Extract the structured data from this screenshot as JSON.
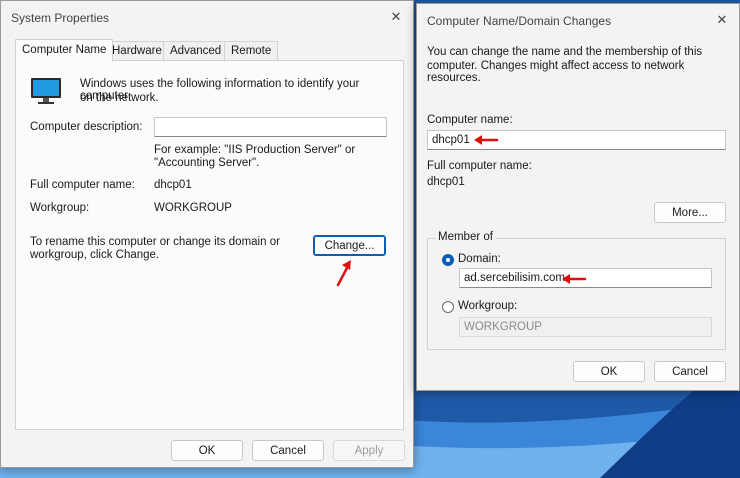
{
  "system_properties": {
    "title": "System Properties",
    "tabs": [
      {
        "label": "Computer Name",
        "active": true
      },
      {
        "label": "Hardware",
        "active": false
      },
      {
        "label": "Advanced",
        "active": false
      },
      {
        "label": "Remote",
        "active": false
      }
    ],
    "intro_line1": "Windows uses the following information to identify your computer",
    "intro_line2": "on the network.",
    "description_label": "Computer description:",
    "description_value": "",
    "example_line1": "For example: \"IIS Production Server\" or",
    "example_line2": "\"Accounting Server\".",
    "full_name_label": "Full computer name:",
    "full_name_value": "dhcp01",
    "workgroup_label": "Workgroup:",
    "workgroup_value": "WORKGROUP",
    "rename_line1": "To rename this computer or change its domain or",
    "rename_line2": "workgroup, click Change.",
    "change_button": "Change...",
    "ok_button": "OK",
    "cancel_button": "Cancel",
    "apply_button": "Apply"
  },
  "domain_changes": {
    "title": "Computer Name/Domain Changes",
    "intro_line1": "You can change the name and the membership of this",
    "intro_line2": "computer. Changes might affect access to network resources.",
    "computer_name_label": "Computer name:",
    "computer_name_value": "dhcp01",
    "full_name_label": "Full computer name:",
    "full_name_value": "dhcp01",
    "more_button": "More...",
    "member_of_label": "Member of",
    "domain_label": "Domain:",
    "domain_value": "ad.sercebilisim.com",
    "domain_selected": true,
    "workgroup_label": "Workgroup:",
    "workgroup_value": "WORKGROUP",
    "ok_button": "OK",
    "cancel_button": "Cancel"
  },
  "icons": {
    "close": "close-icon",
    "computer": "monitor-icon",
    "annotation": "red-arrow-icon"
  },
  "colors": {
    "annotation_red": "#e01010",
    "focus_blue": "#0a5fb4",
    "window_bg": "#f3f3f3"
  }
}
